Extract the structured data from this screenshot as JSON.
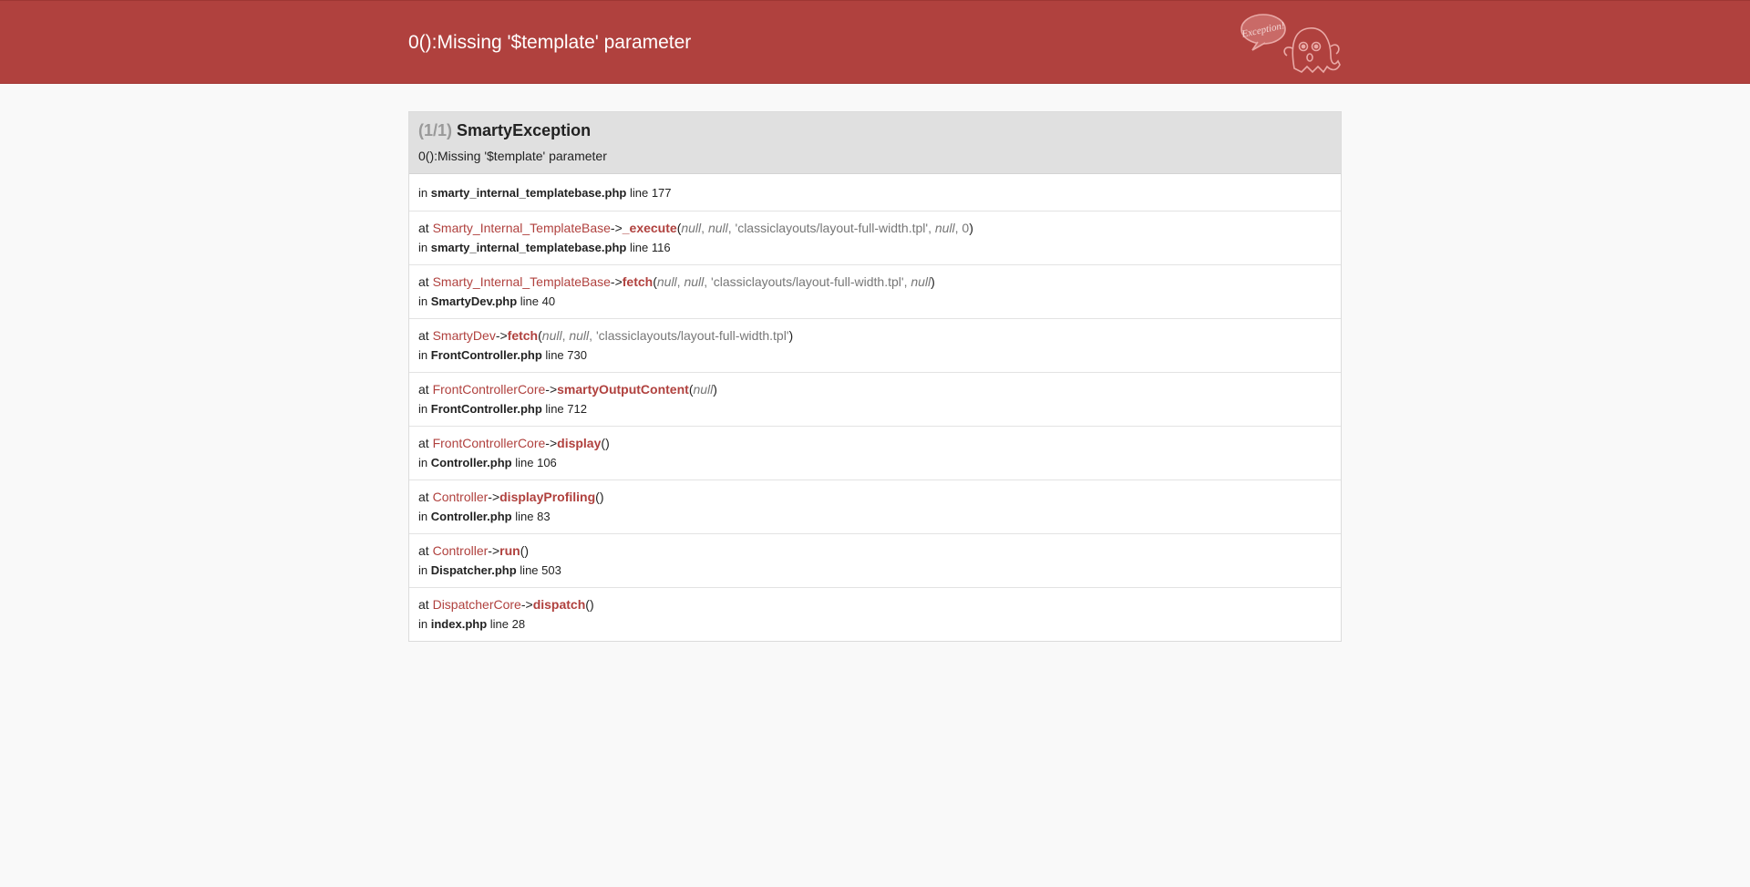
{
  "header": {
    "title": "0():Missing '$template' parameter",
    "logo_text": "Exception!"
  },
  "exception": {
    "count": "(1/1)",
    "class": "SmartyException",
    "message": "0():Missing '$template' parameter"
  },
  "labels": {
    "at": "at",
    "in": "in",
    "line": "line",
    "arrow": "->"
  },
  "first_location": {
    "file": "smarty_internal_templatebase.php",
    "line": "177"
  },
  "trace": [
    {
      "cls": "Smarty_Internal_TemplateBase",
      "fn": "_execute",
      "args": [
        {
          "v": "null",
          "null": true
        },
        {
          "v": "null",
          "null": true
        },
        {
          "v": "'classiclayouts/layout-full-width.tpl'",
          "null": false
        },
        {
          "v": "null",
          "null": true
        },
        {
          "v": "0",
          "null": false
        }
      ],
      "file": "smarty_internal_templatebase.php",
      "line": "116"
    },
    {
      "cls": "Smarty_Internal_TemplateBase",
      "fn": "fetch",
      "args": [
        {
          "v": "null",
          "null": true
        },
        {
          "v": "null",
          "null": true
        },
        {
          "v": "'classiclayouts/layout-full-width.tpl'",
          "null": false
        },
        {
          "v": "null",
          "null": true
        }
      ],
      "file": "SmartyDev.php",
      "line": "40"
    },
    {
      "cls": "SmartyDev",
      "fn": "fetch",
      "args": [
        {
          "v": "null",
          "null": true
        },
        {
          "v": "null",
          "null": true
        },
        {
          "v": "'classiclayouts/layout-full-width.tpl'",
          "null": false
        }
      ],
      "file": "FrontController.php",
      "line": "730"
    },
    {
      "cls": "FrontControllerCore",
      "fn": "smartyOutputContent",
      "args": [
        {
          "v": "null",
          "null": true
        }
      ],
      "file": "FrontController.php",
      "line": "712"
    },
    {
      "cls": "FrontControllerCore",
      "fn": "display",
      "args": [],
      "file": "Controller.php",
      "line": "106"
    },
    {
      "cls": "Controller",
      "fn": "displayProfiling",
      "args": [],
      "file": "Controller.php",
      "line": "83"
    },
    {
      "cls": "Controller",
      "fn": "run",
      "args": [],
      "file": "Dispatcher.php",
      "line": "503"
    },
    {
      "cls": "DispatcherCore",
      "fn": "dispatch",
      "args": [],
      "file": "index.php",
      "line": "28"
    }
  ],
  "colors": {
    "header_bg": "#b0413e",
    "accent": "#b0413e",
    "page_bg": "#f9f9f9"
  }
}
